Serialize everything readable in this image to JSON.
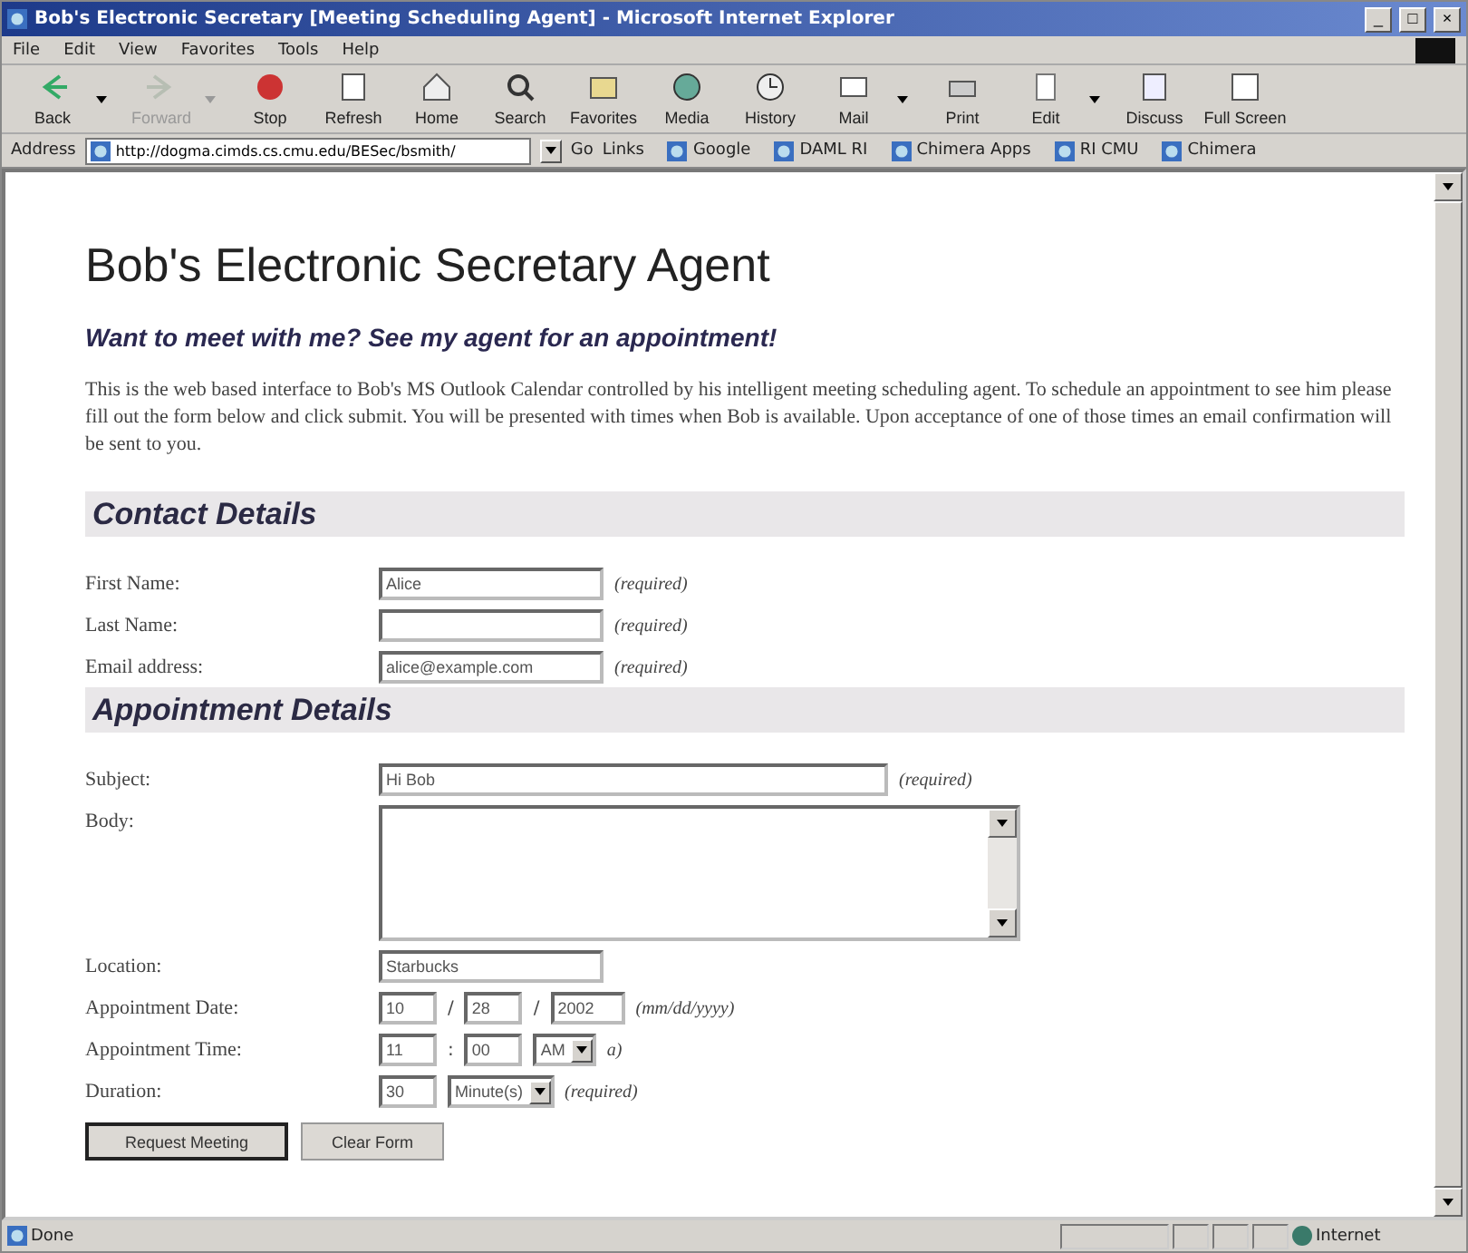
{
  "window": {
    "title": "Bob's Electronic Secretary [Meeting Scheduling Agent] - Microsoft Internet Explorer",
    "controls": [
      "_",
      "□",
      "×"
    ]
  },
  "menu": [
    "File",
    "Edit",
    "View",
    "Favorites",
    "Tools",
    "Help"
  ],
  "toolbar": [
    {
      "label": "Back",
      "disabled": false,
      "dropdown": true
    },
    {
      "label": "Forward",
      "disabled": true,
      "dropdown": true
    },
    {
      "label": "Stop",
      "disabled": false,
      "dropdown": false
    },
    {
      "label": "Refresh",
      "disabled": false,
      "dropdown": false
    },
    {
      "label": "Home",
      "disabled": false,
      "dropdown": false
    },
    {
      "label": "Search",
      "disabled": false,
      "dropdown": false
    },
    {
      "label": "Favorites",
      "disabled": false,
      "dropdown": false
    },
    {
      "label": "Media",
      "disabled": false,
      "dropdown": false
    },
    {
      "label": "History",
      "disabled": false,
      "dropdown": false
    },
    {
      "label": "Mail",
      "disabled": false,
      "dropdown": true
    },
    {
      "label": "Print",
      "disabled": false,
      "dropdown": false
    },
    {
      "label": "Edit",
      "disabled": false,
      "dropdown": true
    },
    {
      "label": "Discuss",
      "disabled": false,
      "dropdown": false
    },
    {
      "label": "Full Screen",
      "disabled": false,
      "dropdown": false
    }
  ],
  "address_bar": {
    "label": "Address",
    "value": "http://dogma.cimds.cs.cmu.edu/BESec/bsmith/",
    "go": "Go",
    "links_label": "Links",
    "links": [
      "Google",
      "DAML RI",
      "Chimera Apps",
      "RI CMU",
      "Chimera"
    ]
  },
  "page": {
    "heading": "Bob's Electronic Secretary Agent",
    "tagline": "Want to meet with me? See my agent for an appointment!",
    "intro": "This is the web based interface to Bob's MS Outlook Calendar controlled by his intelligent meeting scheduling agent. To schedule an appointment to see him please fill out the form below and click submit. You will be presented with times when Bob is available. Upon acceptance of one of those times an email confirmation will be sent to you.",
    "sections": [
      {
        "title": "Contact Details",
        "rows": [
          {
            "label": "First Name:",
            "kind": "text",
            "value": "Alice",
            "note": "(required)"
          },
          {
            "label": "Last Name:",
            "kind": "text",
            "note": "(required)"
          },
          {
            "label": "Email address:",
            "kind": "text",
            "value": "alice@example.com",
            "note": "(required)"
          }
        ]
      },
      {
        "title": "Appointment Details",
        "rows": [
          {
            "label": "Subject:",
            "kind": "long",
            "value": "Hi Bob",
            "note": "(required)"
          },
          {
            "label": "Body:",
            "kind": "textarea"
          },
          {
            "label": "Location:",
            "kind": "text",
            "value": "Starbucks"
          },
          {
            "label": "Appointment Date:",
            "kind": "split",
            "fields": [
              {
                "value": "10",
                "sep": "/"
              },
              {
                "value": "28",
                "sep": "/"
              },
              {
                "value": "2002"
              }
            ],
            "note": "(mm/dd/yyyy)"
          },
          {
            "label": "Appointment Time:",
            "kind": "split",
            "fields": [
              {
                "value": "11",
                "sep": ":"
              },
              {
                "value": "00"
              }
            ],
            "select": "AM",
            "note": "a)"
          },
          {
            "label": "Duration:",
            "kind": "split",
            "fields": [
              {
                "value": "30"
              }
            ],
            "select": "Minute(s)",
            "note": "(required)"
          }
        ]
      }
    ],
    "buttons": [
      {
        "label": "Request Meeting",
        "default": true
      },
      {
        "label": "Clear Form",
        "default": false
      }
    ]
  },
  "status_bar": {
    "text": "Done",
    "zone": "Internet"
  }
}
